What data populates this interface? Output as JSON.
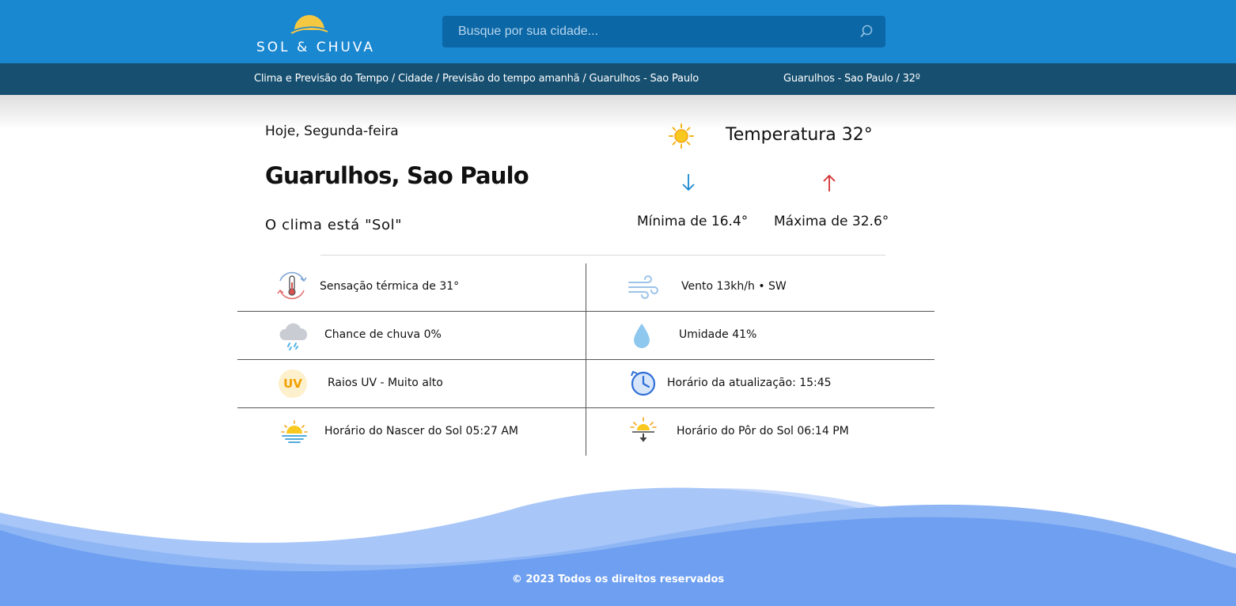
{
  "header": {
    "logo_text": "SOL & CHUVA",
    "search_placeholder": "Busque por sua cidade..."
  },
  "breadcrumb": {
    "path": "Clima e Previsão do Tempo / Cidade / Previsão do tempo amanhã / Guarulhos - Sao Paulo",
    "summary": "Guarulhos - Sao Paulo / 32º"
  },
  "weather": {
    "day": "Hoje, Segunda-feira",
    "city": "Guarulhos, Sao Paulo",
    "condition": "O clima está \"Sol\"",
    "temperature": "Temperatura 32°",
    "min": "Mínima de 16.4°",
    "max": "Máxima de 32.6°"
  },
  "details": [
    {
      "label": "Sensação térmica de 31°",
      "icon": "thermometer-icon"
    },
    {
      "label": "Vento 13kh/h • SW",
      "icon": "wind-icon"
    },
    {
      "label": "Chance de chuva 0%",
      "icon": "rain-cloud-icon"
    },
    {
      "label": "Umidade 41%",
      "icon": "droplet-icon"
    },
    {
      "label": "Raios UV - Muito alto",
      "icon": "uv-icon",
      "badge": "UV"
    },
    {
      "label": "Horário da atualização: 15:45",
      "icon": "clock-icon"
    },
    {
      "label": "Horário do Nascer do Sol 05:27 AM",
      "icon": "sunrise-icon"
    },
    {
      "label": "Horário do Pôr do Sol 06:14 PM",
      "icon": "sunset-icon"
    }
  ],
  "footer": {
    "copyright": "© 2023 Todos os direitos reservados"
  },
  "colors": {
    "header_bg": "#1a87d1",
    "breadcrumb_bg": "#164f70",
    "search_bg": "#0b67a6",
    "arrow_down": "#1a87d1",
    "arrow_up": "#d32f2f",
    "wave": "#6e9ff0"
  }
}
